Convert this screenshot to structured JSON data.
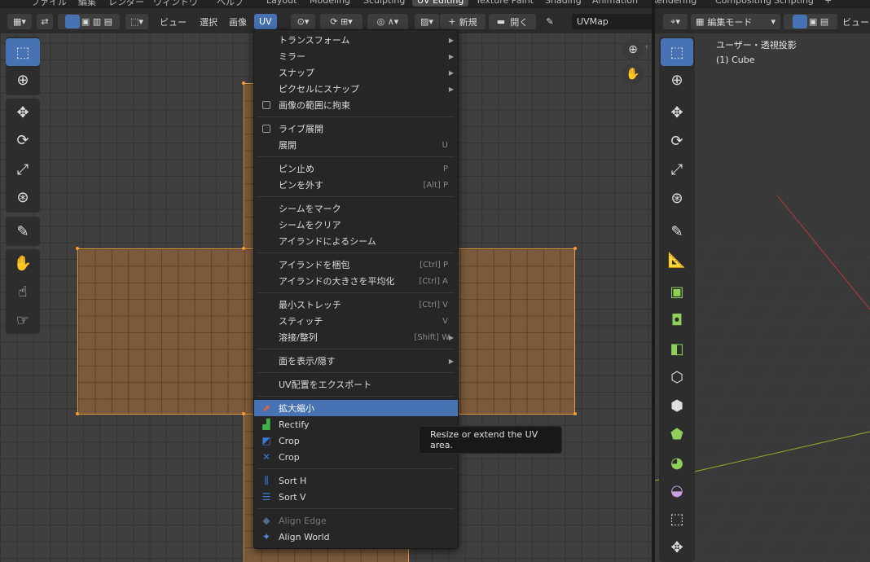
{
  "workspace_tabs": [
    "ファイル",
    "編集",
    "レンダー",
    "ウィンドウ",
    "ヘルプ",
    "Layout",
    "Modeling",
    "Sculpting",
    "UV Editing",
    "Texture Paint",
    "Shading",
    "Animation",
    "Rendering",
    "Compositing",
    "Scripting",
    "+"
  ],
  "uv_header": {
    "menus": [
      "ビュー",
      "選択",
      "画像",
      "UV"
    ],
    "new_label": "新規",
    "open_label": "開く",
    "uvmap_name": "UVMap"
  },
  "uv_menu": {
    "items": [
      {
        "label": "トランスフォーム",
        "shortcut": "",
        "submenu": true
      },
      {
        "label": "ミラー",
        "shortcut": "",
        "submenu": true
      },
      {
        "label": "スナップ",
        "shortcut": "",
        "submenu": true
      },
      {
        "label": "ピクセルにスナップ",
        "shortcut": "",
        "submenu": true
      },
      {
        "label": "画像の範囲に拘束",
        "checkbox": true
      },
      {
        "label": "ライブ展開",
        "checkbox": true
      },
      {
        "label": "展開",
        "shortcut": "U"
      },
      {
        "label": "ピン止め",
        "shortcut": "P"
      },
      {
        "label": "ピンを外す",
        "shortcut": "[Alt] P"
      },
      {
        "label": "シームをマーク",
        "shortcut": ""
      },
      {
        "label": "シームをクリア",
        "shortcut": ""
      },
      {
        "label": "アイランドによるシーム",
        "shortcut": ""
      },
      {
        "label": "アイランドを梱包",
        "shortcut": "[Ctrl] P"
      },
      {
        "label": "アイランドの大きさを平均化",
        "shortcut": "[Ctrl] A"
      },
      {
        "label": "最小ストレッチ",
        "shortcut": "[Ctrl] V"
      },
      {
        "label": "スティッチ",
        "shortcut": "V"
      },
      {
        "label": "溶接/整列",
        "shortcut": "[Shift] W",
        "submenu": true
      },
      {
        "label": "面を表示/隠す",
        "shortcut": "",
        "submenu": true
      },
      {
        "label": "UV配置をエクスポート",
        "shortcut": ""
      },
      {
        "label": "拡大縮小",
        "icon": "scale-uv-icon",
        "highlighted": true
      },
      {
        "label": "Rectify",
        "icon": "rectify-icon"
      },
      {
        "label": "Crop",
        "icon": "crop-icon"
      },
      {
        "label": "Crop",
        "icon": "crop-fill-icon"
      },
      {
        "label": "Sort H",
        "icon": "sort-h-icon"
      },
      {
        "label": "Sort V",
        "icon": "sort-v-icon"
      },
      {
        "label": "Align Edge",
        "icon": "align-edge-icon",
        "disabled": true
      },
      {
        "label": "Align World",
        "icon": "align-world-icon"
      }
    ]
  },
  "tooltip": "Resize or extend the UV area.",
  "v3d": {
    "mode_label": "編集モード",
    "view_menu": "ビュー",
    "overlay_title": "ユーザー・透視投影",
    "overlay_object": "(1) Cube"
  },
  "colors": {
    "accent": "#4772b3",
    "island_fill": "#7a5a3a",
    "island_edge": "#e09b45"
  }
}
